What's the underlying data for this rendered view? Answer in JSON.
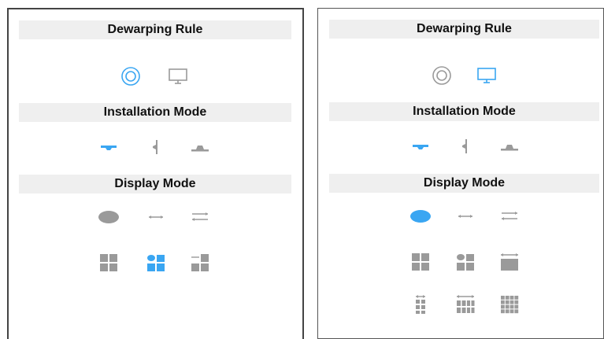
{
  "colors": {
    "active": "#3aa6f2",
    "inactive": "#9a9a9a",
    "header_bg": "#efefef"
  },
  "left_panel": {
    "sections": {
      "dewarping_rule": "Dewarping Rule",
      "installation_mode": "Installation Mode",
      "display_mode": "Display Mode"
    },
    "dewarping_rule_icons": [
      {
        "name": "fisheye-icon",
        "state": "selected"
      },
      {
        "name": "monitor-icon",
        "state": "normal"
      }
    ],
    "installation_mode_icons": [
      {
        "name": "ceiling-mount-icon",
        "state": "selected"
      },
      {
        "name": "wall-mount-icon",
        "state": "normal"
      },
      {
        "name": "desktop-mount-icon",
        "state": "normal"
      }
    ],
    "display_mode_icons": [
      {
        "name": "original-view-icon",
        "state": "normal"
      },
      {
        "name": "panorama-180-icon",
        "state": "normal"
      },
      {
        "name": "panorama-360-icon",
        "state": "normal"
      },
      {
        "name": "quad-view-icon",
        "state": "normal"
      },
      {
        "name": "fisheye-plus-3-icon",
        "state": "selected"
      },
      {
        "name": "panorama-plus-3-icon",
        "state": "normal"
      }
    ]
  },
  "right_panel": {
    "sections": {
      "dewarping_rule": "Dewarping Rule",
      "installation_mode": "Installation Mode",
      "display_mode": "Display Mode"
    },
    "dewarping_rule_icons": [
      {
        "name": "fisheye-icon",
        "state": "normal"
      },
      {
        "name": "monitor-icon",
        "state": "selected"
      }
    ],
    "installation_mode_icons": [
      {
        "name": "ceiling-mount-icon",
        "state": "selected"
      },
      {
        "name": "wall-mount-icon",
        "state": "normal"
      },
      {
        "name": "desktop-mount-icon",
        "state": "normal"
      }
    ],
    "display_mode_icons": [
      {
        "name": "original-view-icon",
        "state": "selected"
      },
      {
        "name": "panorama-180-icon",
        "state": "normal"
      },
      {
        "name": "panorama-360-icon",
        "state": "normal"
      },
      {
        "name": "quad-view-icon",
        "state": "normal"
      },
      {
        "name": "fisheye-plus-3-icon",
        "state": "normal"
      },
      {
        "name": "panorama-plus-1-icon",
        "state": "normal"
      },
      {
        "name": "panorama-plus-6-icon",
        "state": "normal"
      },
      {
        "name": "panorama-plus-8-icon",
        "state": "normal"
      },
      {
        "name": "grid-9-icon",
        "state": "normal"
      }
    ]
  }
}
